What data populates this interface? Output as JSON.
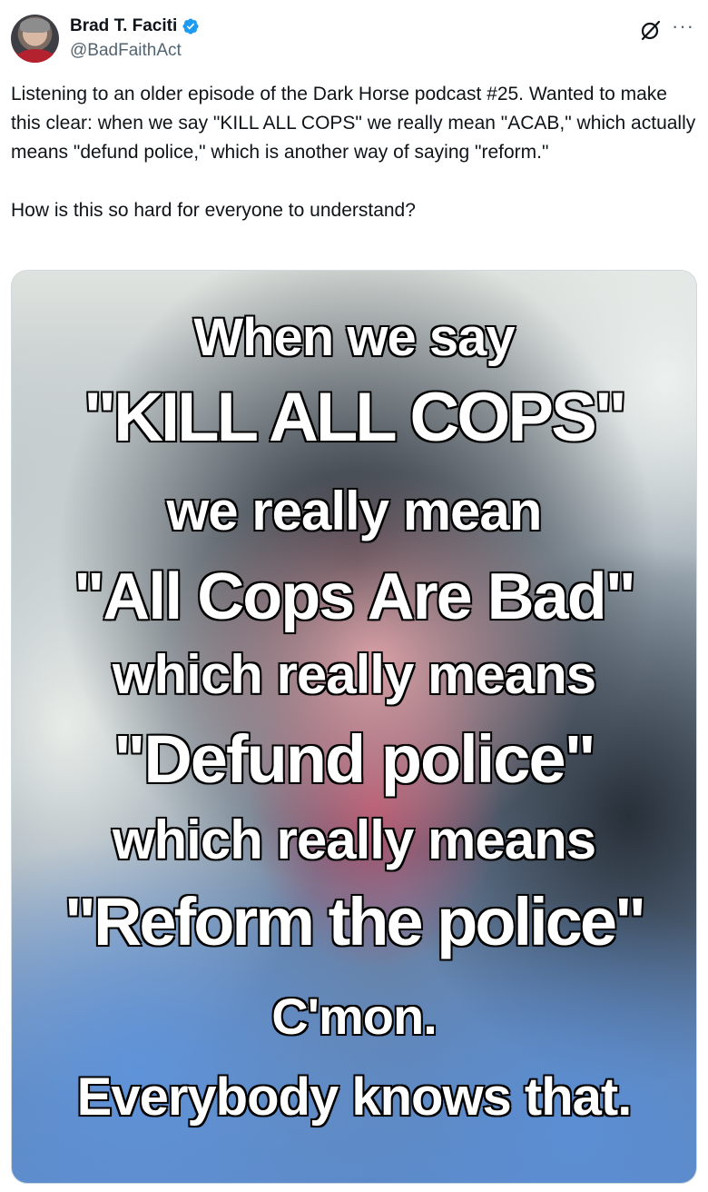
{
  "author": {
    "name": "Brad T. Faciti",
    "handle": "@BadFaithAct",
    "verified": true
  },
  "icons": {
    "verified": "verified-badge-icon",
    "grok": "grok-icon",
    "more": "more-options-icon"
  },
  "more_label": "···",
  "post": {
    "paragraph1": "Listening to an older episode of the Dark Horse podcast #25. Wanted to make this clear: when we say \"KILL ALL COPS\" we really mean \"ACAB,\" which actually means \"defund police,\" which is another way of saying \"reform.\"",
    "paragraph2": "How is this so hard for everyone to understand?"
  },
  "media": {
    "lines": [
      "When we say",
      "\"KILL ALL COPS\"",
      "we really mean",
      "\"All Cops Are Bad\"",
      "which really means",
      "\"Defund police\"",
      "which really means",
      "\"Reform the police\"",
      "C'mon.",
      "Everybody knows that."
    ]
  },
  "colors": {
    "text": "#0f1419",
    "secondary": "#536471",
    "verified_blue": "#1d9bf0",
    "border": "#cfd9de"
  }
}
